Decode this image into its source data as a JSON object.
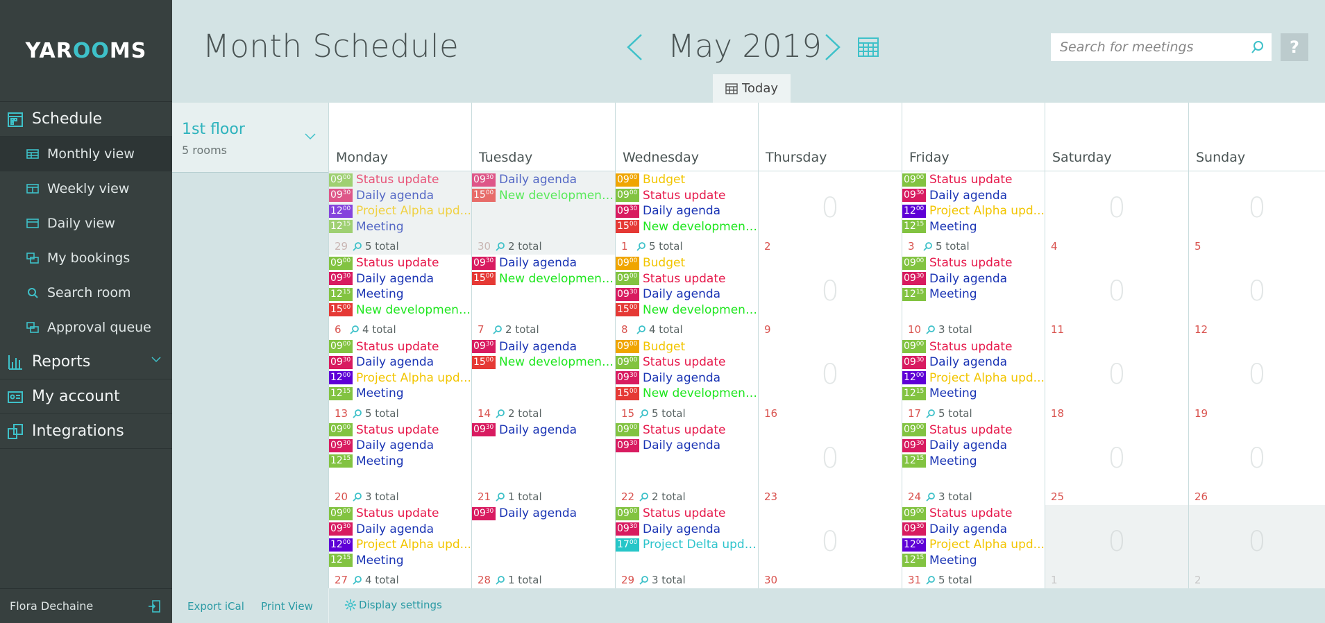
{
  "app": {
    "logo_text_left": "YAR",
    "logo_text_mid": "OO",
    "logo_text_right": "MS"
  },
  "sidebar": {
    "schedule_label": "Schedule",
    "sub_items": [
      {
        "label": "Monthly view",
        "icon": "table-icon",
        "active": true
      },
      {
        "label": "Weekly view",
        "icon": "week-icon",
        "active": false
      },
      {
        "label": "Daily view",
        "icon": "day-icon",
        "active": false
      },
      {
        "label": "My bookings",
        "icon": "bookings-icon",
        "active": false
      },
      {
        "label": "Search room",
        "icon": "search-icon",
        "active": false
      },
      {
        "label": "Approval queue",
        "icon": "queue-icon",
        "active": false
      }
    ],
    "reports_label": "Reports",
    "account_label": "My account",
    "integrations_label": "Integrations",
    "user_name": "Flora Dechaine"
  },
  "header": {
    "title": "Month Schedule",
    "month": "May 2019",
    "search_placeholder": "Search for meetings",
    "help_label": "?",
    "today_label": "Today"
  },
  "room": {
    "name": "1st floor",
    "count": "5 rooms"
  },
  "weekdays": [
    "Monday",
    "Tuesday",
    "Wednesday",
    "Thursday",
    "Friday",
    "Saturday",
    "Sunday"
  ],
  "colors": {
    "accent": "#3ec1c9",
    "sidebar_bg": "#37403f",
    "header_bg": "#d3e3e4",
    "status_update": "#e6194b",
    "daily_agenda": "#1a34b4",
    "project_alpha": "#f2c500",
    "meeting": "#1a34b4",
    "new_development": "#1ee61e",
    "budget": "#f2c500",
    "project_delta": "#2ec4cc"
  },
  "footer": {
    "export_label": "Export iCal",
    "print_label": "Print View",
    "display_settings_label": "Display settings"
  },
  "weeks": [
    [
      {
        "day": "29",
        "state": "past",
        "total": "5 total",
        "events": [
          {
            "h": "09",
            "m": "00",
            "title": "Status update",
            "tc": "#82c341",
            "fc": "#e6194b"
          },
          {
            "h": "09",
            "m": "30",
            "title": "Daily agenda",
            "tc": "#d81b60",
            "fc": "#1a34b4"
          },
          {
            "h": "12",
            "m": "00",
            "title": "Project Alpha upd...",
            "tc": "#5e00d6",
            "fc": "#f2c500"
          },
          {
            "h": "12",
            "m": "15",
            "title": "Meeting",
            "tc": "#82c341",
            "fc": "#1a34b4"
          }
        ]
      },
      {
        "day": "30",
        "state": "past",
        "total": "2 total",
        "events": [
          {
            "h": "09",
            "m": "30",
            "title": "Daily agenda",
            "tc": "#d81b60",
            "fc": "#1a34b4"
          },
          {
            "h": "15",
            "m": "00",
            "title": "New development...",
            "tc": "#e53935",
            "fc": "#1ee61e"
          }
        ]
      },
      {
        "day": "1",
        "state": "normal",
        "total": "5 total",
        "events": [
          {
            "h": "09",
            "m": "00",
            "title": "Budget",
            "tc": "#f0a500",
            "fc": "#f2c500"
          },
          {
            "h": "09",
            "m": "00",
            "title": "Status update",
            "tc": "#82c341",
            "fc": "#e6194b"
          },
          {
            "h": "09",
            "m": "30",
            "title": "Daily agenda",
            "tc": "#d81b60",
            "fc": "#1a34b4"
          },
          {
            "h": "15",
            "m": "00",
            "title": "New development...",
            "tc": "#e53935",
            "fc": "#1ee61e"
          }
        ]
      },
      {
        "day": "2",
        "state": "normal",
        "total": "",
        "zero": "0",
        "events": []
      },
      {
        "day": "3",
        "state": "normal",
        "total": "5 total",
        "events": [
          {
            "h": "09",
            "m": "00",
            "title": "Status update",
            "tc": "#82c341",
            "fc": "#e6194b"
          },
          {
            "h": "09",
            "m": "30",
            "title": "Daily agenda",
            "tc": "#d81b60",
            "fc": "#1a34b4"
          },
          {
            "h": "12",
            "m": "00",
            "title": "Project Alpha upd...",
            "tc": "#5e00d6",
            "fc": "#f2c500"
          },
          {
            "h": "12",
            "m": "15",
            "title": "Meeting",
            "tc": "#82c341",
            "fc": "#1a34b4"
          }
        ]
      },
      {
        "day": "4",
        "state": "normal",
        "total": "",
        "zero": "0",
        "events": []
      },
      {
        "day": "5",
        "state": "normal",
        "total": "",
        "zero": "0",
        "events": []
      }
    ],
    [
      {
        "day": "6",
        "state": "normal",
        "total": "4 total",
        "events": [
          {
            "h": "09",
            "m": "00",
            "title": "Status update",
            "tc": "#82c341",
            "fc": "#e6194b"
          },
          {
            "h": "09",
            "m": "30",
            "title": "Daily agenda",
            "tc": "#d81b60",
            "fc": "#1a34b4"
          },
          {
            "h": "12",
            "m": "15",
            "title": "Meeting",
            "tc": "#82c341",
            "fc": "#1a34b4"
          },
          {
            "h": "15",
            "m": "00",
            "title": "New development...",
            "tc": "#e53935",
            "fc": "#1ee61e"
          }
        ]
      },
      {
        "day": "7",
        "state": "normal",
        "total": "2 total",
        "events": [
          {
            "h": "09",
            "m": "30",
            "title": "Daily agenda",
            "tc": "#d81b60",
            "fc": "#1a34b4"
          },
          {
            "h": "15",
            "m": "00",
            "title": "New development...",
            "tc": "#e53935",
            "fc": "#1ee61e"
          }
        ]
      },
      {
        "day": "8",
        "state": "normal",
        "total": "4 total",
        "events": [
          {
            "h": "09",
            "m": "00",
            "title": "Budget",
            "tc": "#f0a500",
            "fc": "#f2c500"
          },
          {
            "h": "09",
            "m": "00",
            "title": "Status update",
            "tc": "#82c341",
            "fc": "#e6194b"
          },
          {
            "h": "09",
            "m": "30",
            "title": "Daily agenda",
            "tc": "#d81b60",
            "fc": "#1a34b4"
          },
          {
            "h": "15",
            "m": "00",
            "title": "New development...",
            "tc": "#e53935",
            "fc": "#1ee61e"
          }
        ]
      },
      {
        "day": "9",
        "state": "normal",
        "total": "",
        "zero": "0",
        "events": []
      },
      {
        "day": "10",
        "state": "normal",
        "total": "3 total",
        "events": [
          {
            "h": "09",
            "m": "00",
            "title": "Status update",
            "tc": "#82c341",
            "fc": "#e6194b"
          },
          {
            "h": "09",
            "m": "30",
            "title": "Daily agenda",
            "tc": "#d81b60",
            "fc": "#1a34b4"
          },
          {
            "h": "12",
            "m": "15",
            "title": "Meeting",
            "tc": "#82c341",
            "fc": "#1a34b4"
          }
        ]
      },
      {
        "day": "11",
        "state": "normal",
        "total": "",
        "zero": "0",
        "events": []
      },
      {
        "day": "12",
        "state": "normal",
        "total": "",
        "zero": "0",
        "events": []
      }
    ],
    [
      {
        "day": "13",
        "state": "normal",
        "total": "5 total",
        "events": [
          {
            "h": "09",
            "m": "00",
            "title": "Status update",
            "tc": "#82c341",
            "fc": "#e6194b"
          },
          {
            "h": "09",
            "m": "30",
            "title": "Daily agenda",
            "tc": "#d81b60",
            "fc": "#1a34b4"
          },
          {
            "h": "12",
            "m": "00",
            "title": "Project Alpha upd...",
            "tc": "#5e00d6",
            "fc": "#f2c500"
          },
          {
            "h": "12",
            "m": "15",
            "title": "Meeting",
            "tc": "#82c341",
            "fc": "#1a34b4"
          }
        ]
      },
      {
        "day": "14",
        "state": "normal",
        "total": "2 total",
        "events": [
          {
            "h": "09",
            "m": "30",
            "title": "Daily agenda",
            "tc": "#d81b60",
            "fc": "#1a34b4"
          },
          {
            "h": "15",
            "m": "00",
            "title": "New development...",
            "tc": "#e53935",
            "fc": "#1ee61e"
          }
        ]
      },
      {
        "day": "15",
        "state": "normal",
        "total": "5 total",
        "events": [
          {
            "h": "09",
            "m": "00",
            "title": "Budget",
            "tc": "#f0a500",
            "fc": "#f2c500"
          },
          {
            "h": "09",
            "m": "00",
            "title": "Status update",
            "tc": "#82c341",
            "fc": "#e6194b"
          },
          {
            "h": "09",
            "m": "30",
            "title": "Daily agenda",
            "tc": "#d81b60",
            "fc": "#1a34b4"
          },
          {
            "h": "15",
            "m": "00",
            "title": "New development...",
            "tc": "#e53935",
            "fc": "#1ee61e"
          }
        ]
      },
      {
        "day": "16",
        "state": "normal",
        "total": "",
        "zero": "0",
        "events": []
      },
      {
        "day": "17",
        "state": "normal",
        "total": "5 total",
        "events": [
          {
            "h": "09",
            "m": "00",
            "title": "Status update",
            "tc": "#82c341",
            "fc": "#e6194b"
          },
          {
            "h": "09",
            "m": "30",
            "title": "Daily agenda",
            "tc": "#d81b60",
            "fc": "#1a34b4"
          },
          {
            "h": "12",
            "m": "00",
            "title": "Project Alpha upd...",
            "tc": "#5e00d6",
            "fc": "#f2c500"
          },
          {
            "h": "12",
            "m": "15",
            "title": "Meeting",
            "tc": "#82c341",
            "fc": "#1a34b4"
          }
        ]
      },
      {
        "day": "18",
        "state": "normal",
        "total": "",
        "zero": "0",
        "events": []
      },
      {
        "day": "19",
        "state": "normal",
        "total": "",
        "zero": "0",
        "events": []
      }
    ],
    [
      {
        "day": "20",
        "state": "normal",
        "total": "3 total",
        "events": [
          {
            "h": "09",
            "m": "00",
            "title": "Status update",
            "tc": "#82c341",
            "fc": "#e6194b"
          },
          {
            "h": "09",
            "m": "30",
            "title": "Daily agenda",
            "tc": "#d81b60",
            "fc": "#1a34b4"
          },
          {
            "h": "12",
            "m": "15",
            "title": "Meeting",
            "tc": "#82c341",
            "fc": "#1a34b4"
          }
        ]
      },
      {
        "day": "21",
        "state": "normal",
        "total": "1 total",
        "events": [
          {
            "h": "09",
            "m": "30",
            "title": "Daily agenda",
            "tc": "#d81b60",
            "fc": "#1a34b4"
          }
        ]
      },
      {
        "day": "22",
        "state": "normal",
        "total": "2 total",
        "events": [
          {
            "h": "09",
            "m": "00",
            "title": "Status update",
            "tc": "#82c341",
            "fc": "#e6194b"
          },
          {
            "h": "09",
            "m": "30",
            "title": "Daily agenda",
            "tc": "#d81b60",
            "fc": "#1a34b4"
          }
        ]
      },
      {
        "day": "23",
        "state": "normal",
        "total": "",
        "zero": "0",
        "events": []
      },
      {
        "day": "24",
        "state": "normal",
        "total": "3 total",
        "events": [
          {
            "h": "09",
            "m": "00",
            "title": "Status update",
            "tc": "#82c341",
            "fc": "#e6194b"
          },
          {
            "h": "09",
            "m": "30",
            "title": "Daily agenda",
            "tc": "#d81b60",
            "fc": "#1a34b4"
          },
          {
            "h": "12",
            "m": "15",
            "title": "Meeting",
            "tc": "#82c341",
            "fc": "#1a34b4"
          }
        ]
      },
      {
        "day": "25",
        "state": "normal",
        "total": "",
        "zero": "0",
        "events": []
      },
      {
        "day": "26",
        "state": "normal",
        "total": "",
        "zero": "0",
        "events": []
      }
    ],
    [
      {
        "day": "27",
        "state": "normal",
        "total": "4 total",
        "events": [
          {
            "h": "09",
            "m": "00",
            "title": "Status update",
            "tc": "#82c341",
            "fc": "#e6194b"
          },
          {
            "h": "09",
            "m": "30",
            "title": "Daily agenda",
            "tc": "#d81b60",
            "fc": "#1a34b4"
          },
          {
            "h": "12",
            "m": "00",
            "title": "Project Alpha upd...",
            "tc": "#5e00d6",
            "fc": "#f2c500"
          },
          {
            "h": "12",
            "m": "15",
            "title": "Meeting",
            "tc": "#82c341",
            "fc": "#1a34b4"
          }
        ]
      },
      {
        "day": "28",
        "state": "normal",
        "total": "1 total",
        "events": [
          {
            "h": "09",
            "m": "30",
            "title": "Daily agenda",
            "tc": "#d81b60",
            "fc": "#1a34b4"
          }
        ]
      },
      {
        "day": "29",
        "state": "normal",
        "total": "3 total",
        "events": [
          {
            "h": "09",
            "m": "00",
            "title": "Status update",
            "tc": "#82c341",
            "fc": "#e6194b"
          },
          {
            "h": "09",
            "m": "30",
            "title": "Daily agenda",
            "tc": "#d81b60",
            "fc": "#1a34b4"
          },
          {
            "h": "17",
            "m": "00",
            "title": "Project Delta upda...",
            "tc": "#26c6c8",
            "fc": "#2ec4cc"
          }
        ]
      },
      {
        "day": "30",
        "state": "normal",
        "total": "",
        "zero": "0",
        "events": []
      },
      {
        "day": "31",
        "state": "normal",
        "total": "5 total",
        "events": [
          {
            "h": "09",
            "m": "00",
            "title": "Status update",
            "tc": "#82c341",
            "fc": "#e6194b"
          },
          {
            "h": "09",
            "m": "30",
            "title": "Daily agenda",
            "tc": "#d81b60",
            "fc": "#1a34b4"
          },
          {
            "h": "12",
            "m": "00",
            "title": "Project Alpha upd...",
            "tc": "#5e00d6",
            "fc": "#f2c500"
          },
          {
            "h": "12",
            "m": "15",
            "title": "Meeting",
            "tc": "#82c341",
            "fc": "#1a34b4"
          }
        ]
      },
      {
        "day": "1",
        "state": "outside",
        "total": "",
        "zero": "0",
        "events": []
      },
      {
        "day": "2",
        "state": "outside",
        "total": "",
        "zero": "0",
        "events": []
      }
    ]
  ]
}
